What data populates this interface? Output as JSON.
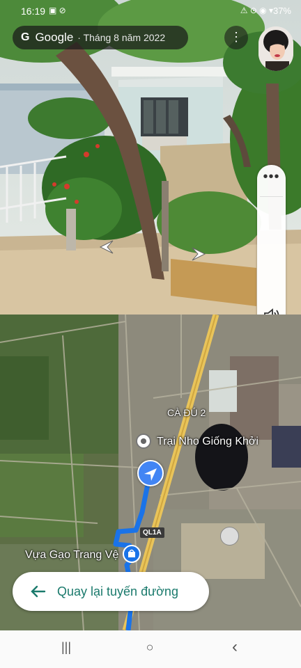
{
  "status_bar": {
    "time": "16:19",
    "left_icons": "▣ ⊘",
    "right_icons": "⚠ ⊙ ◉ ▾",
    "battery": "37%"
  },
  "street_view": {
    "google_logo": "G",
    "google_label": "Google",
    "capture_date": "· Tháng 8 năm 2022",
    "more_icon": "⋮",
    "control_dots": "•••"
  },
  "map": {
    "area_label": "CÀ ĐÚ 2",
    "place_top": "Trại Nho Giống Khởi",
    "place_bottom": "Vựa Gạo Trang Vệ",
    "road_shield": "QL1A",
    "route_color": "#1a73e8",
    "road_color": "#e9c45a"
  },
  "back_button": {
    "label": "Quay lại tuyến đường",
    "accent": "#1a7a6c"
  },
  "system_nav": {
    "recents": "|||",
    "home": "○",
    "back": "‹"
  }
}
